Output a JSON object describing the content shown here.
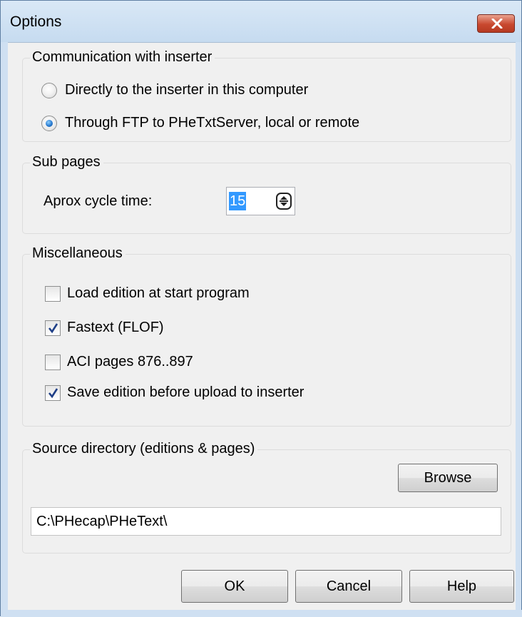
{
  "window": {
    "title": "Options"
  },
  "communication": {
    "legend": "Communication with inserter",
    "options": [
      {
        "label": "Directly to the inserter in this computer",
        "checked": false
      },
      {
        "label": "Through FTP to PHeTxtServer, local or remote",
        "checked": true
      }
    ]
  },
  "sub_pages": {
    "legend": "Sub pages",
    "cycle_label": "Aprox cycle time:",
    "cycle_value": "15"
  },
  "misc": {
    "legend": "Miscellaneous",
    "options": [
      {
        "label": "Load edition at start program",
        "checked": false
      },
      {
        "label": "Fastext (FLOF)",
        "checked": true
      },
      {
        "label": "ACI pages 876..897",
        "checked": false
      },
      {
        "label": "Save edition before upload to inserter",
        "checked": true
      }
    ]
  },
  "source": {
    "legend": "Source directory (editions & pages)",
    "browse_label": "Browse",
    "path_value": "C:\\PHecap\\PHeText\\"
  },
  "buttons": {
    "ok": "OK",
    "cancel": "Cancel",
    "help": "Help"
  },
  "colors": {
    "accent_selection": "#3399ff",
    "close_button": "#c9482f",
    "window_frame": "#cfe0f2"
  },
  "icons": {
    "close": "close-icon",
    "spin": "spin-arrows-icon",
    "check": "checkmark-icon"
  }
}
